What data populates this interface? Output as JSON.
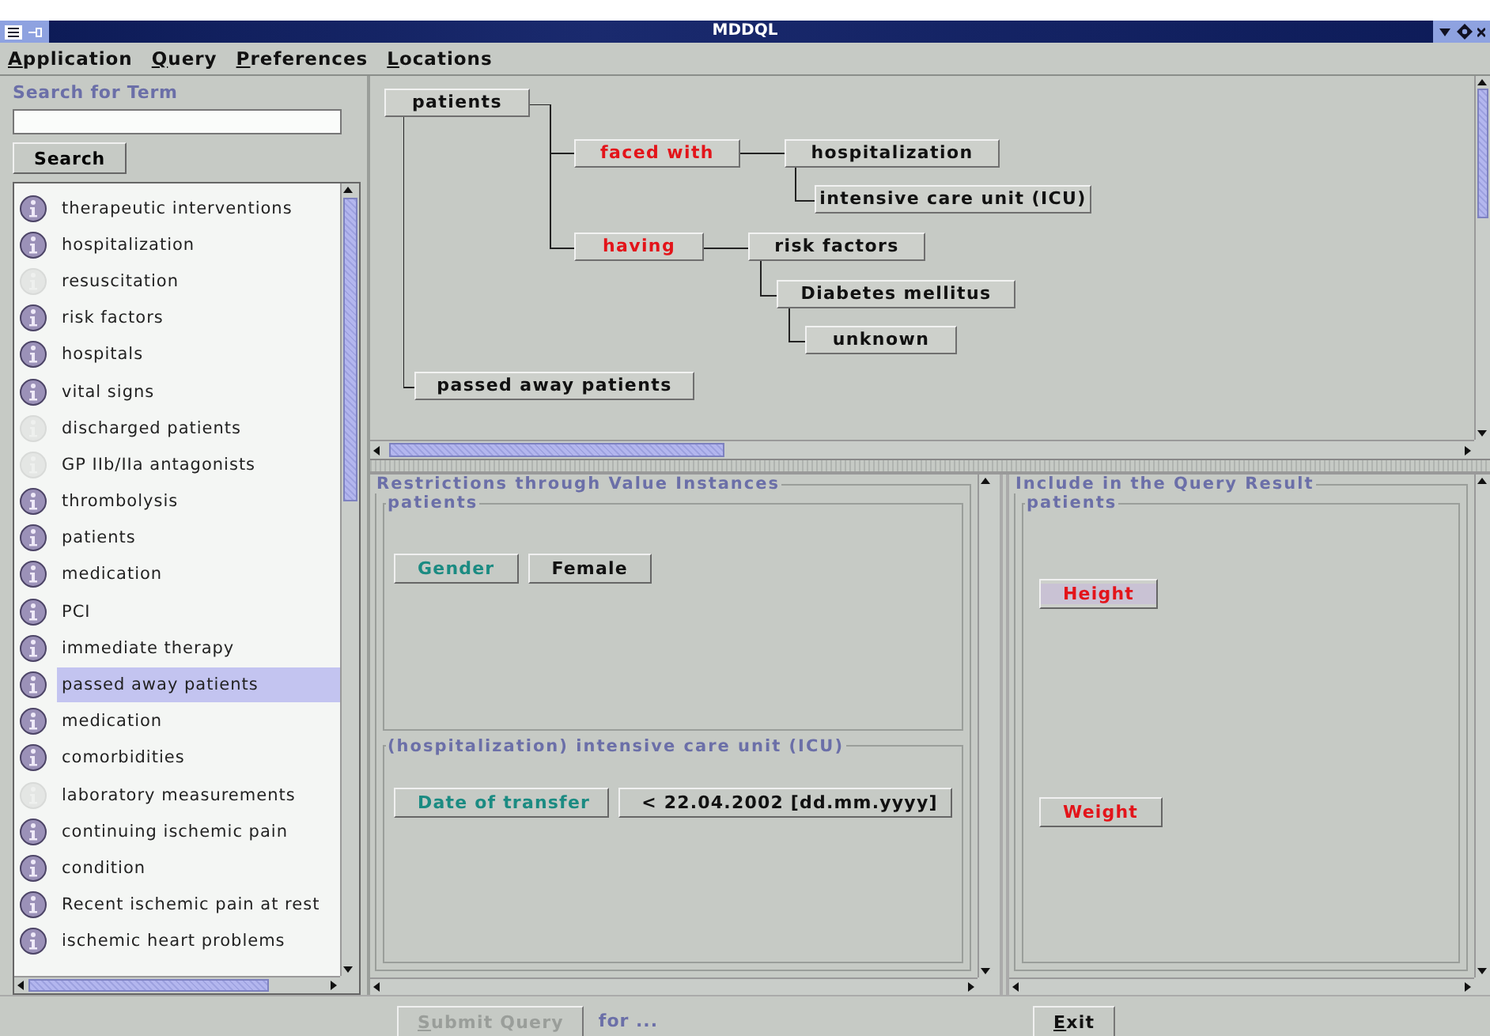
{
  "window": {
    "title": "MDDQL"
  },
  "menu": [
    {
      "label": "Application"
    },
    {
      "label": "Query"
    },
    {
      "label": "Preferences"
    },
    {
      "label": "Locations"
    }
  ],
  "search": {
    "label": "Search for Term",
    "button": "Search"
  },
  "terms": [
    {
      "label": "therapeutic interventions",
      "available": true,
      "selected": false
    },
    {
      "label": "hospitalization",
      "available": true,
      "selected": false
    },
    {
      "label": "resuscitation",
      "available": false,
      "selected": false
    },
    {
      "label": "risk factors",
      "available": true,
      "selected": false
    },
    {
      "label": "hospitals",
      "available": true,
      "selected": false
    },
    {
      "label": "vital signs",
      "available": true,
      "selected": false
    },
    {
      "label": "discharged patients",
      "available": false,
      "selected": false
    },
    {
      "label": "GP IIb/IIa antagonists",
      "available": false,
      "selected": false
    },
    {
      "label": "thrombolysis",
      "available": true,
      "selected": false
    },
    {
      "label": "patients",
      "available": true,
      "selected": false
    },
    {
      "label": "medication",
      "available": true,
      "selected": false
    },
    {
      "label": "PCI",
      "available": true,
      "selected": false
    },
    {
      "label": "immediate therapy",
      "available": true,
      "selected": false
    },
    {
      "label": "passed away patients",
      "available": true,
      "selected": true
    },
    {
      "label": "medication",
      "available": true,
      "selected": false
    },
    {
      "label": "comorbidities",
      "available": true,
      "selected": false
    },
    {
      "label": "laboratory measurements",
      "available": false,
      "selected": false
    },
    {
      "label": "continuing ischemic pain",
      "available": true,
      "selected": false
    },
    {
      "label": "condition",
      "available": true,
      "selected": false
    },
    {
      "label": "Recent ischemic pain at rest",
      "available": true,
      "selected": false
    },
    {
      "label": "ischemic heart problems",
      "available": true,
      "selected": false
    }
  ],
  "query_tree": {
    "root": {
      "label": "patients",
      "kind": "concept",
      "children": [
        {
          "label": "faced with",
          "kind": "relation",
          "children": [
            {
              "label": "hospitalization",
              "kind": "concept",
              "children": [
                {
                  "label": "intensive care unit (ICU)",
                  "kind": "concept"
                }
              ]
            }
          ]
        },
        {
          "label": "having",
          "kind": "relation",
          "children": [
            {
              "label": "risk factors",
              "kind": "concept",
              "children": [
                {
                  "label": "Diabetes mellitus",
                  "kind": "concept",
                  "children": [
                    {
                      "label": "unknown",
                      "kind": "concept"
                    }
                  ]
                }
              ]
            }
          ]
        },
        {
          "label": "passed away patients",
          "kind": "concept"
        }
      ]
    }
  },
  "restrictions": {
    "title": "Restrictions through Value Instances",
    "groups": [
      {
        "title": "patients",
        "items": [
          {
            "attribute": "Gender",
            "value": "Female"
          }
        ]
      },
      {
        "title": "(hospitalization) intensive care unit (ICU)",
        "items": [
          {
            "attribute": "Date of transfer",
            "value": "<  22.04.2002 [dd.mm.yyyy]"
          }
        ]
      }
    ]
  },
  "result": {
    "title": "Include in the Query Result",
    "groups": [
      {
        "title": "patients",
        "items": [
          {
            "label": "Height",
            "focused": true
          },
          {
            "label": "Weight",
            "focused": false
          }
        ]
      }
    ]
  },
  "status_bar": {
    "submit": {
      "label": "Submit Query",
      "disabled": true
    },
    "target": "for ...",
    "exit": "Exit"
  }
}
